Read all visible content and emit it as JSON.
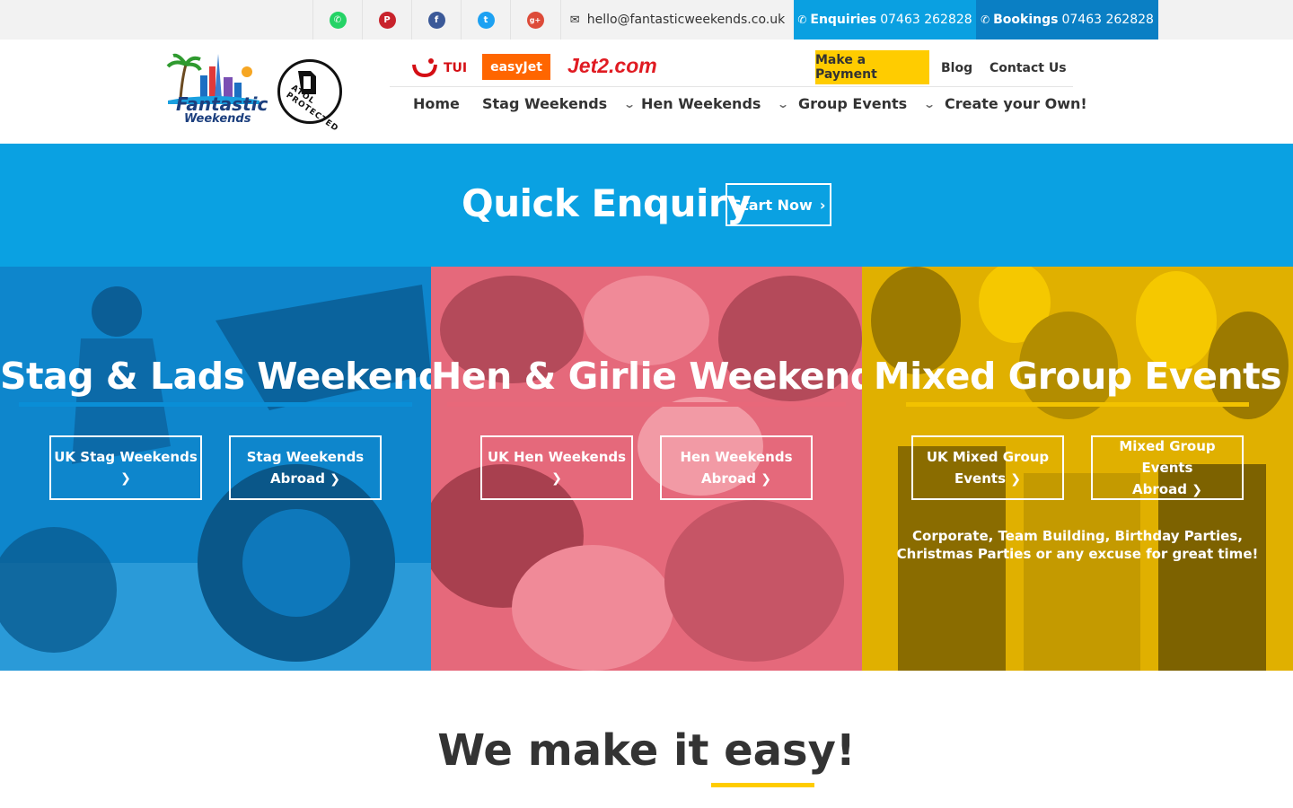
{
  "topbar": {
    "social": [
      {
        "name": "whatsapp-icon",
        "color": "#25d366",
        "glyph": "✆"
      },
      {
        "name": "pinterest-icon",
        "color": "#c8232c",
        "glyph": "P"
      },
      {
        "name": "facebook-icon",
        "color": "#3b5998",
        "glyph": "f"
      },
      {
        "name": "twitter-icon",
        "color": "#1da1f2",
        "glyph": "t"
      },
      {
        "name": "googleplus-icon",
        "color": "#dd4b39",
        "glyph": "g+"
      }
    ],
    "email": "hello@fantasticweekends.co.uk",
    "enquiries_label": "Enquiries",
    "enquiries_phone": "07463 262828",
    "bookings_label": "Bookings",
    "bookings_phone": "07463 262828"
  },
  "header": {
    "logo_title": "Fantastic",
    "logo_subtitle": "Weekends",
    "atol_text": "ATOL PROTECTED",
    "brands": {
      "tui": "TUI",
      "easyjet": "easyJet",
      "jet2": "Jet2.com"
    },
    "make_payment": "Make a Payment",
    "blog": "Blog",
    "contact": "Contact Us",
    "nav": {
      "home": "Home",
      "stag": "Stag Weekends",
      "hen": "Hen Weekends",
      "group": "Group Events",
      "create": "Create your Own!"
    }
  },
  "quick": {
    "title": "Quick Enquiry",
    "button": "Start Now"
  },
  "panels": {
    "stag": {
      "title": "Stag & Lads Weekends",
      "btn1": "UK Stag Weekends",
      "btn2_line1": "Stag Weekends",
      "btn2_line2": "Abroad",
      "color": "#0a8ed6"
    },
    "hen": {
      "title": "Hen & Girlie Weekends",
      "btn1": "UK Hen Weekends",
      "btn2_line1": "Hen Weekends",
      "btn2_line2": "Abroad",
      "color": "#e8687a"
    },
    "mixed": {
      "title": "Mixed Group Events",
      "btn1_line1": "UK Mixed Group",
      "btn1_line2": "Events",
      "btn2_line1": "Mixed Group Events",
      "btn2_line2": "Abroad",
      "text": "Corporate, Team Building, Birthday Parties, Christmas Parties or any excuse for great time!",
      "color": "#f2c200"
    }
  },
  "easy": {
    "title": "We make it easy!"
  }
}
